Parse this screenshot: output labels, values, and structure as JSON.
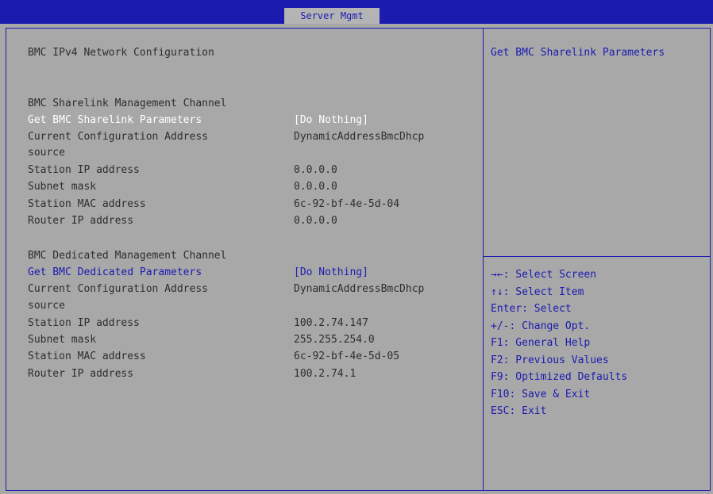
{
  "header": {
    "tab_label": "Server Mgmt"
  },
  "main": {
    "section_title": "BMC IPv4 Network Configuration",
    "sharelink": {
      "heading": "BMC Sharelink Management Channel",
      "get_param_label": "Get BMC Sharelink Parameters",
      "get_param_value": "[Do Nothing]",
      "config_source_label_1": "Current Configuration Address",
      "config_source_label_2": "source",
      "config_source_value": "DynamicAddressBmcDhcp",
      "station_ip_label": "Station IP address",
      "station_ip_value": "0.0.0.0",
      "subnet_label": "Subnet mask",
      "subnet_value": "0.0.0.0",
      "mac_label": "Station MAC address",
      "mac_value": "6c-92-bf-4e-5d-04",
      "router_label": "Router IP address",
      "router_value": "0.0.0.0"
    },
    "dedicated": {
      "heading": "BMC Dedicated Management Channel",
      "get_param_label": "Get BMC Dedicated Parameters",
      "get_param_value": "[Do Nothing]",
      "config_source_label_1": "Current Configuration Address",
      "config_source_label_2": "source",
      "config_source_value": "DynamicAddressBmcDhcp",
      "station_ip_label": "Station IP address",
      "station_ip_value": "100.2.74.147",
      "subnet_label": "Subnet mask",
      "subnet_value": "255.255.254.0",
      "mac_label": "Station MAC address",
      "mac_value": "6c-92-bf-4e-5d-05",
      "router_label": "Router IP address",
      "router_value": "100.2.74.1"
    }
  },
  "help": {
    "text": "Get BMC Sharelink Parameters"
  },
  "keys": [
    "→←: Select Screen",
    "↑↓: Select Item",
    "Enter: Select",
    "+/-: Change Opt.",
    "F1: General Help",
    "F2: Previous Values",
    "F9: Optimized Defaults",
    "F10: Save & Exit",
    "ESC: Exit"
  ]
}
